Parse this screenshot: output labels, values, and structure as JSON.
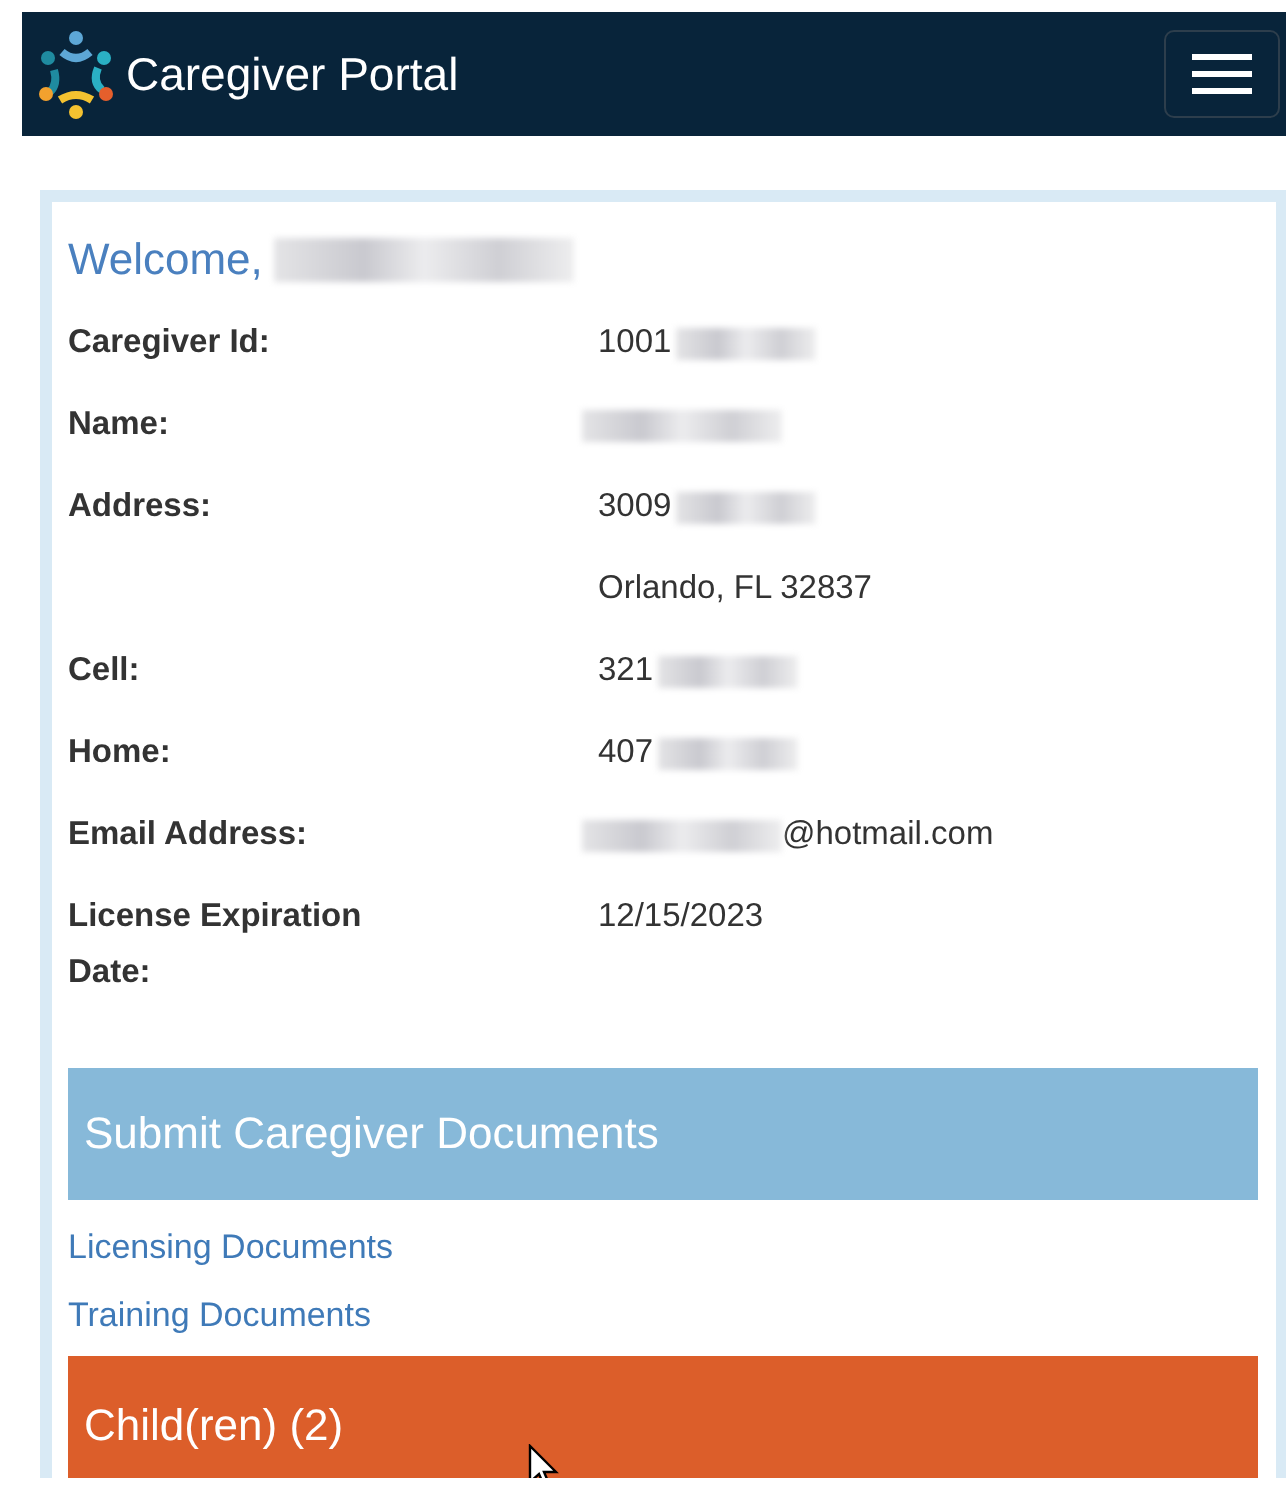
{
  "navbar": {
    "title": "Caregiver Portal"
  },
  "welcome": {
    "greeting": "Welcome,",
    "name_redacted": true
  },
  "details": [
    {
      "label": "Caregiver Id:",
      "lines": [
        {
          "text": "1001",
          "redacted": true
        }
      ]
    },
    {
      "label": "Name:",
      "lines": [
        {
          "redacted": true
        }
      ]
    },
    {
      "label": "Address:",
      "lines": [
        {
          "text": "3009",
          "redacted": true
        },
        {
          "text": "Orlando, FL 32837"
        }
      ]
    },
    {
      "label": "Cell:",
      "lines": [
        {
          "text": "321",
          "redacted": true
        }
      ]
    },
    {
      "label": "Home:",
      "lines": [
        {
          "text": "407",
          "redacted": true
        }
      ]
    },
    {
      "label": "Email Address:",
      "lines": [
        {
          "suffix": "@hotmail.com",
          "redacted": true
        }
      ]
    },
    {
      "label": "License Expiration Date:",
      "lines": [
        {
          "text": "12/15/2023"
        }
      ]
    }
  ],
  "documents": {
    "header": "Submit Caregiver Documents",
    "links": [
      "Licensing Documents",
      "Training Documents"
    ]
  },
  "children": {
    "header": "Child(ren) (2)"
  }
}
